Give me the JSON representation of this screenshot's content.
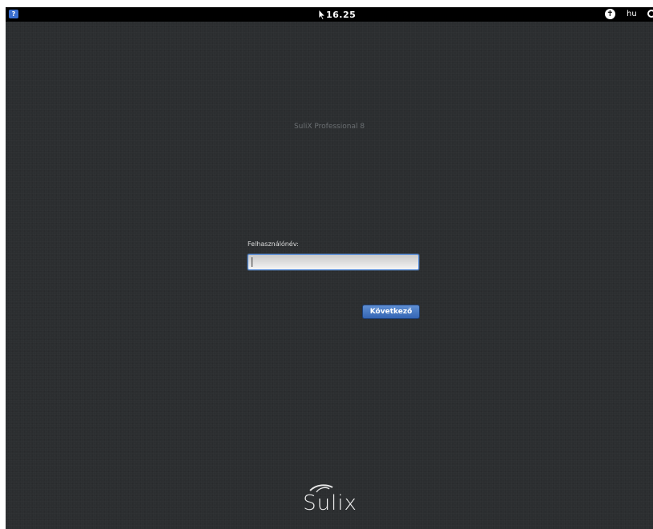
{
  "topbar": {
    "accessibility_left_glyph": "?",
    "clock": "16.25",
    "accessibility_right_glyph": "✝",
    "language": "hu"
  },
  "greeter": {
    "distro_title": "SuliX Professional 8",
    "username_label": "Felhasználónév:",
    "username_value": "",
    "next_button": "Következő"
  },
  "logo": {
    "text": "Sulix"
  },
  "colors": {
    "background": "#2b2e30",
    "panel": "#000000",
    "button": "#3f6fbd",
    "input_border": "#5b8fd8"
  },
  "icons": [
    "accessibility-icon",
    "mouse-cursor-icon",
    "universal-access-icon",
    "power-icon"
  ]
}
